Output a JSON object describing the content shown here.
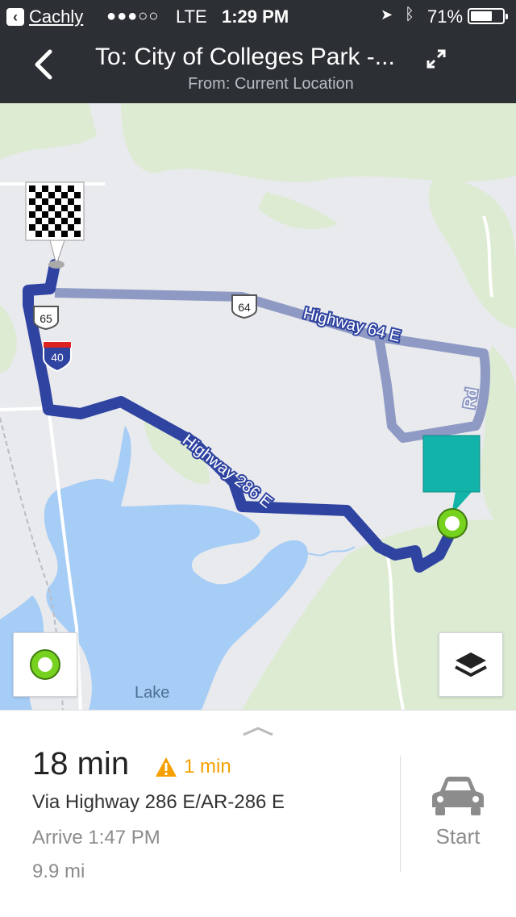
{
  "status_bar": {
    "back_app": "Cachly",
    "signal": "●●●○○",
    "carrier": "LTE",
    "time": "1:29 PM",
    "battery": "71%",
    "battery_level": 0.71
  },
  "header": {
    "back_icon": "chevron-left-icon",
    "title": "To: City of Colleges Park -...",
    "subtitle": "From: Current Location",
    "expand_icon": "expand-icon"
  },
  "map": {
    "road_labels": {
      "hwy64": "Highway 64 E",
      "hwy286": "Highway 286 E",
      "rd": "Rd",
      "lake": "Lake"
    },
    "shields": {
      "us64": "64",
      "us65": "65",
      "i40": "40"
    },
    "colors": {
      "route_primary": "#2f43a0",
      "route_alt": "#8f9ac4",
      "water": "#a6cdf5",
      "forest": "#dcebd2",
      "destination_pin": "#12b3a8",
      "origin_ring": "#77d11f"
    },
    "buttons": {
      "locate_icon": "locate-icon",
      "layers_icon": "layers-icon"
    }
  },
  "route_card": {
    "duration": "18 min",
    "delay": "1 min",
    "via": "Via Highway 286 E/AR-286 E",
    "arrive": "Arrive 1:47 PM",
    "distance": "9.9 mi",
    "start_label": "Start"
  }
}
